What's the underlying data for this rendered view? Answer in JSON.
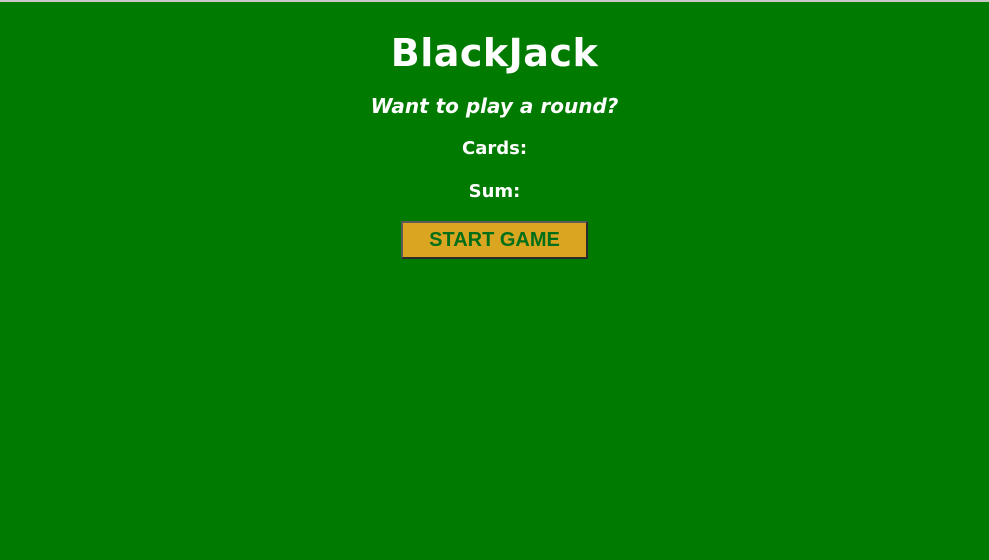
{
  "page": {
    "title": "BlackJack",
    "message": "Want to play a round?",
    "cards_label": "Cards:",
    "sum_label": "Sum:",
    "start_button_label": "START GAME"
  },
  "colors": {
    "table_green": "#007b00",
    "button_gold": "#daa520",
    "button_text_green": "#016f19",
    "text_white": "#ffffff"
  }
}
